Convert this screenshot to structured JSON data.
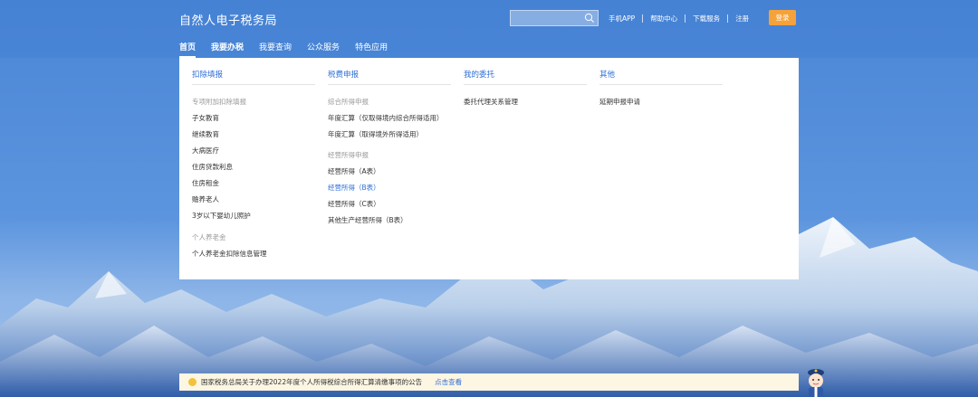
{
  "header": {
    "site_title": "自然人电子税务局",
    "search": {
      "value": "",
      "placeholder": "",
      "icon": "search-icon"
    },
    "links": [
      "手机APP",
      "帮助中心",
      "下载服务",
      "注册"
    ],
    "login_label": "登录"
  },
  "nav": {
    "items": [
      "首页",
      "我要办税",
      "我要查询",
      "公众服务",
      "特色应用"
    ],
    "active_index": 0
  },
  "dropdown": {
    "columns": [
      {
        "title": "扣除填报",
        "groups": [
          {
            "name": "专项附加扣除填报",
            "items": [
              "子女教育",
              "继续教育",
              "大病医疗",
              "住房贷款利息",
              "住房租金",
              "赡养老人",
              "3岁以下婴幼儿照护"
            ]
          },
          {
            "name": "个人养老金",
            "items": [
              "个人养老金扣除信息管理"
            ]
          }
        ]
      },
      {
        "title": "税费申报",
        "groups": [
          {
            "name": "综合所得申报",
            "items": [
              "年度汇算（仅取得境内综合所得适用）",
              "年度汇算（取得境外所得适用）"
            ]
          },
          {
            "name": "经营所得申报",
            "items": [
              "经营所得（A表）",
              "经营所得（B表）",
              "经营所得（C表）",
              "其他生产经营所得（B表）"
            ]
          }
        ]
      },
      {
        "title": "我的委托",
        "groups": [
          {
            "name": "",
            "items": [
              "委托代理关系管理"
            ]
          }
        ]
      },
      {
        "title": "其他",
        "groups": [
          {
            "name": "",
            "items": [
              "延期申报申请"
            ]
          }
        ]
      }
    ],
    "highlight_item": "经营所得（B表）"
  },
  "notice": {
    "text": "国家税务总局关于办理2022年度个人所得税综合所得汇算清缴事项的公告",
    "link_label": "点击查看"
  },
  "colors": {
    "accent": "#2f6fd6",
    "login": "#f5a23a",
    "notice_bg": "#fdf6e3",
    "notice_dot": "#f2c23a"
  }
}
